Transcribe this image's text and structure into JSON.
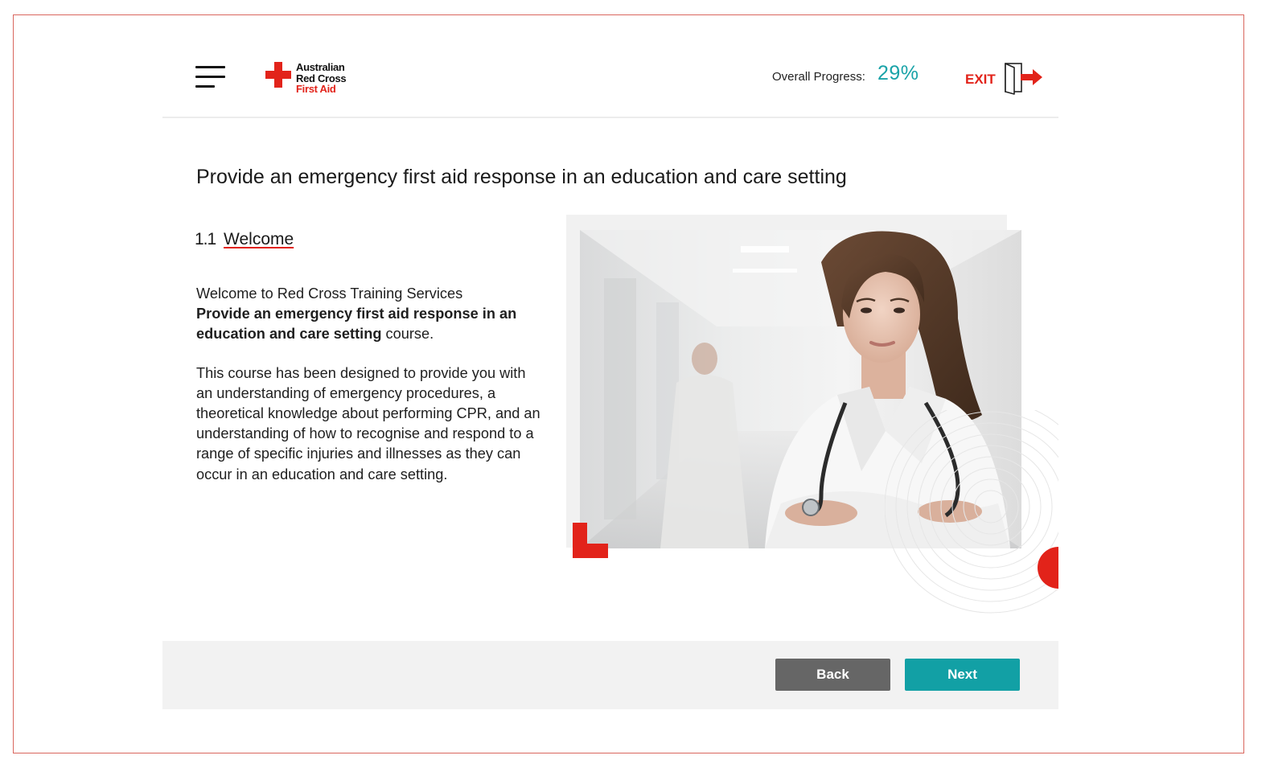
{
  "header": {
    "logo": {
      "line1": "Australian",
      "line2": "Red Cross",
      "line3": "First Aid"
    },
    "progress_label": "Overall Progress:",
    "progress_value": "29%",
    "progress_fraction": 0.29,
    "exit_label": "EXIT"
  },
  "content": {
    "page_title": "Provide an emergency first aid response in an education and care setting",
    "section_number": "1.1",
    "section_title": "Welcome",
    "intro_line": "Welcome to Red Cross Training Services",
    "course_name": "Provide an emergency first aid response in an education and care setting",
    "course_suffix": " course.",
    "description": "This course has been designed to provide you with an understanding of emergency procedures, a theoretical knowledge about performing CPR, and an understanding of how to recognise and respond to a range of specific injuries and illnesses as they can occur in an education and care setting."
  },
  "footer": {
    "back_label": "Back",
    "next_label": "Next"
  },
  "colors": {
    "brand_red": "#e2231a",
    "teal": "#1aa3a8",
    "back_button": "#666666",
    "next_button": "#12a0a5",
    "footer_bg": "#f2f2f2"
  },
  "icons": {
    "menu": "hamburger-icon",
    "exit": "exit-door-icon",
    "logo": "red-cross-icon"
  }
}
